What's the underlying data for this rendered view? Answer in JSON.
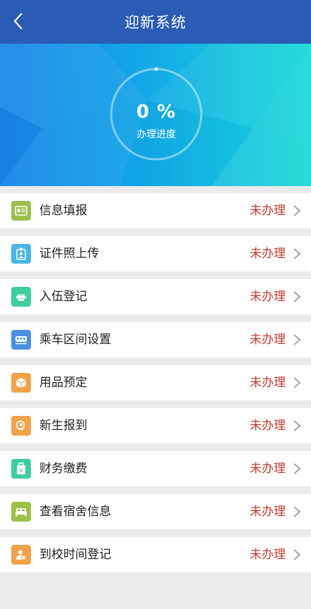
{
  "header": {
    "title": "迎新系统",
    "back_icon": "chevron-left-icon"
  },
  "progress": {
    "value_text": "0 %",
    "label": "办理进度",
    "fraction": 0.0
  },
  "items": [
    {
      "label": "信息填报",
      "status": "未办理",
      "icon": "id-card-icon",
      "color": "#9cc04a"
    },
    {
      "label": "证件照上传",
      "status": "未办理",
      "icon": "photo-badge-icon",
      "color": "#4ab6e6"
    },
    {
      "label": "入伍登记",
      "status": "未办理",
      "icon": "military-cap-icon",
      "color": "#3ecf9a"
    },
    {
      "label": "乘车区间设置",
      "status": "未办理",
      "icon": "train-icon",
      "color": "#4a90e2"
    },
    {
      "label": "用品预定",
      "status": "未办理",
      "icon": "box-icon",
      "color": "#f0a24a"
    },
    {
      "label": "新生报到",
      "status": "未办理",
      "icon": "user-check-icon",
      "color": "#f0a24a"
    },
    {
      "label": "财务缴费",
      "status": "未办理",
      "icon": "wallet-icon",
      "color": "#3ecf9a"
    },
    {
      "label": "查看宿舍信息",
      "status": "未办理",
      "icon": "bed-icon",
      "color": "#9cc04a"
    },
    {
      "label": "到校时间登记",
      "status": "未办理",
      "icon": "user-clock-icon",
      "color": "#f0a24a"
    }
  ]
}
